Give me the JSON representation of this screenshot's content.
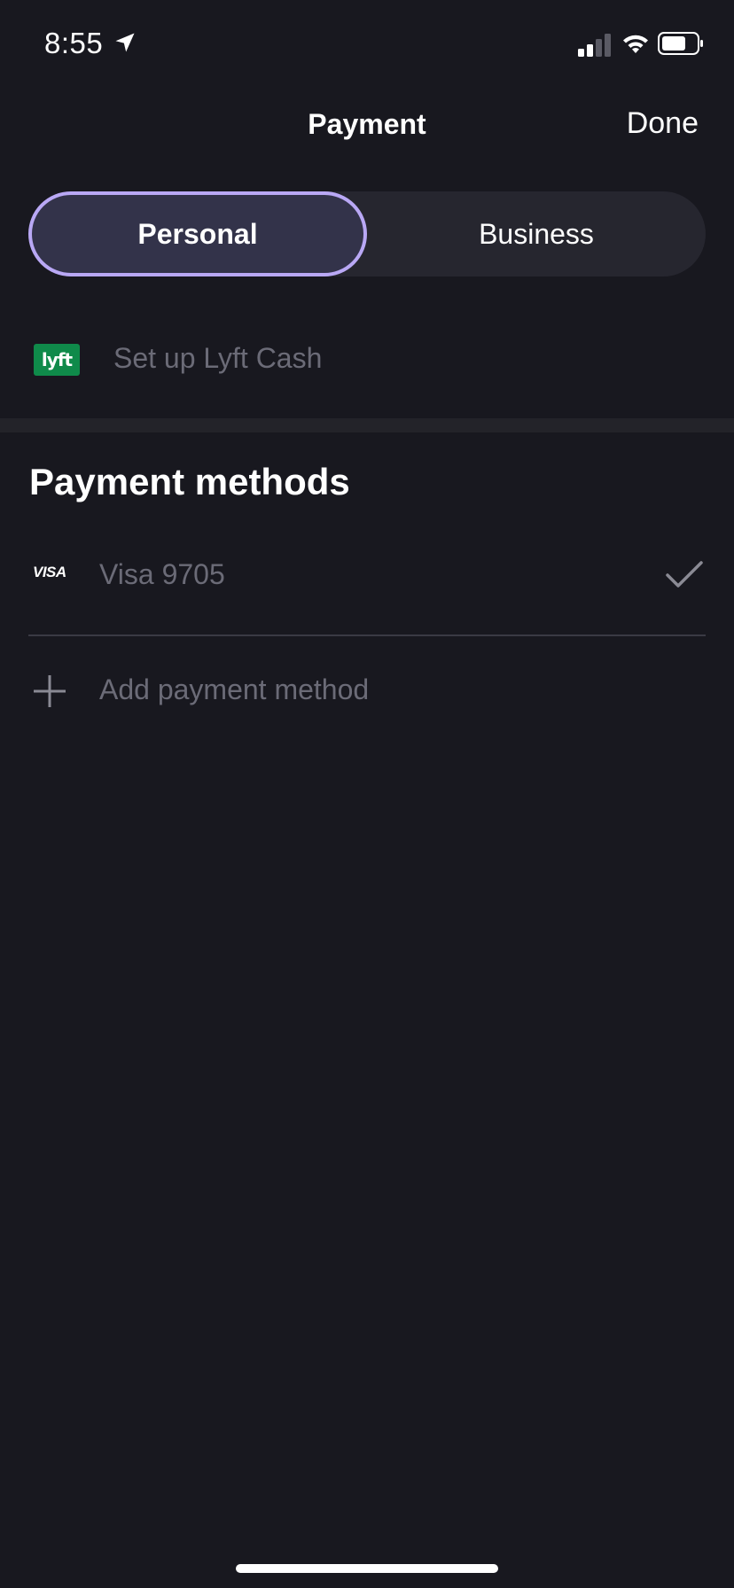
{
  "status_bar": {
    "time": "8:55"
  },
  "nav": {
    "title": "Payment",
    "done_label": "Done"
  },
  "segments": {
    "personal": "Personal",
    "business": "Business",
    "selected": "Personal"
  },
  "lyft_cash": {
    "logo_text": "lyft",
    "label": "Set up Lyft Cash"
  },
  "payment_methods": {
    "title": "Payment methods",
    "items": [
      {
        "brand": "VISA",
        "label": "Visa 9705",
        "selected": true
      }
    ],
    "add_label": "Add payment method"
  },
  "colors": {
    "background": "#18181f",
    "accent_border": "#b9a8f5",
    "lyft_green": "#0f8a4a",
    "muted_text": "#6b6b77"
  }
}
